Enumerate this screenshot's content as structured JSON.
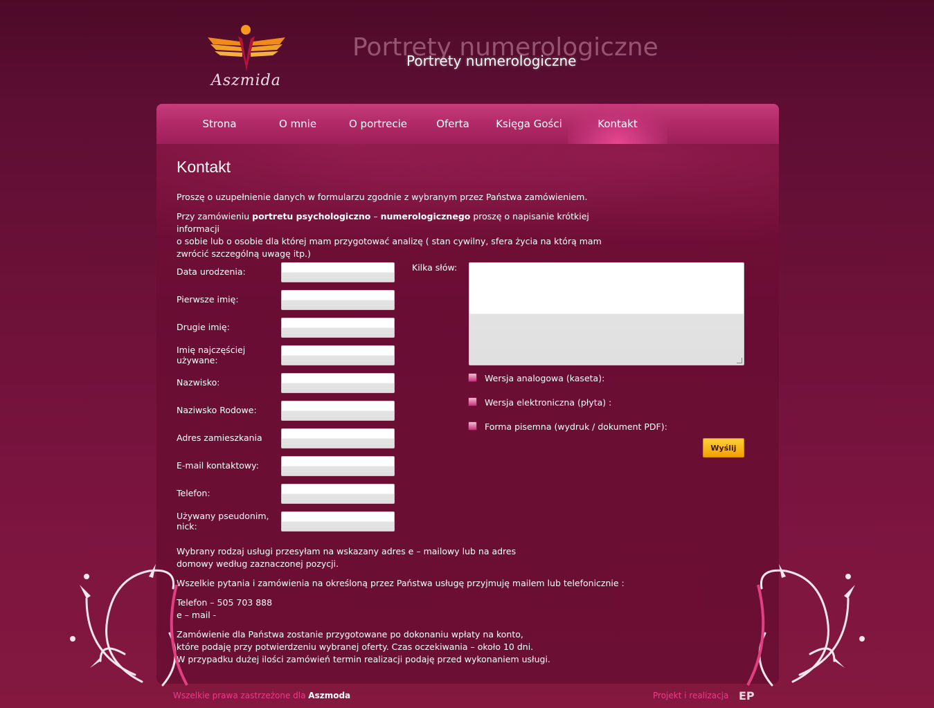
{
  "header": {
    "logo_text": "Aszmida",
    "title_ghost": "Portrety numerologiczne",
    "title": "Portrety numerologiczne"
  },
  "nav": {
    "items": [
      {
        "label": "Strona"
      },
      {
        "label": "O mnie"
      },
      {
        "label": "O portrecie"
      },
      {
        "label": "Oferta"
      },
      {
        "label": "Księga Gości"
      },
      {
        "label": "Kontakt"
      }
    ],
    "active": "Kontakt"
  },
  "main": {
    "heading": "Kontakt",
    "intro": "Proszę o uzupełnienie danych w formularzu zgodnie z wybranym przez Państwa zamówieniem.",
    "order_text": {
      "p1": "Przy zamówieniu ",
      "b1": "portretu psychologiczno",
      "p2": " – ",
      "b2": "numerologicznego",
      "p3": " proszę o napisanie krótkiej informacji",
      "line2": "o sobie lub o osobie dla której mam przygotować analizę ( stan cywilny, sfera życia na którą mam",
      "line3": "zwrócić szczególną uwagę itp.)"
    },
    "form": {
      "fields": [
        {
          "label": "Data urodzenia:",
          "value": ""
        },
        {
          "label": "Pierwsze imię:",
          "value": ""
        },
        {
          "label": "Drugie imię:",
          "value": ""
        },
        {
          "label": "Imię najczęściej używane:",
          "value": ""
        },
        {
          "label": "Nazwisko:",
          "value": ""
        },
        {
          "label": "Naziwsko Rodowe:",
          "value": ""
        },
        {
          "label": "Adres zamieszkania",
          "value": ""
        },
        {
          "label": "E-mail kontaktowy:",
          "value": ""
        },
        {
          "label": "Telefon:",
          "value": ""
        },
        {
          "label": "Używany pseudonim, nick:",
          "value": ""
        }
      ],
      "message_label": "Kilka słów:",
      "message_value": "",
      "options": [
        {
          "label": "Wersja analogowa (kaseta):",
          "checked": false
        },
        {
          "label": "Wersja elektroniczna (płyta) :",
          "checked": false
        },
        {
          "label": "Forma pisemna (wydruk / dokument PDF):",
          "checked": false
        }
      ],
      "submit_label": "Wyślij"
    },
    "info": {
      "service_line1": "Wybrany rodzaj usługi przesyłam na wskazany adres e – mailowy lub na adres",
      "service_line2": "domowy według zaznaczonej pozycji.",
      "questions": "Wszelkie pytania i zamówienia na określoną przez Państwa usługę przyjmuję mailem lub telefonicznie :",
      "phone": "Telefon – 505 703 888",
      "email": "e – mail -",
      "order_line1": "Zamówienie dla Państwa zostanie przygotowane po dokonaniu wpłaty na konto,",
      "order_line2": "które podaję przy potwierdzeniu wybranej oferty. Czas oczekiwania – około 10 dni.",
      "order_line3": "W przypadku dużej ilości zamówień termin realizacji podaję przed wykonaniem usługi."
    }
  },
  "footer": {
    "rights": "Wszelkie prawa zastrzeżone dla ",
    "brand": "Aszmoda",
    "project": "Projekt i realizacja",
    "ep_logo": "EP"
  },
  "colors": {
    "accent": "#ec3c88",
    "nav": "#b02a67",
    "button": "#f5a000"
  }
}
